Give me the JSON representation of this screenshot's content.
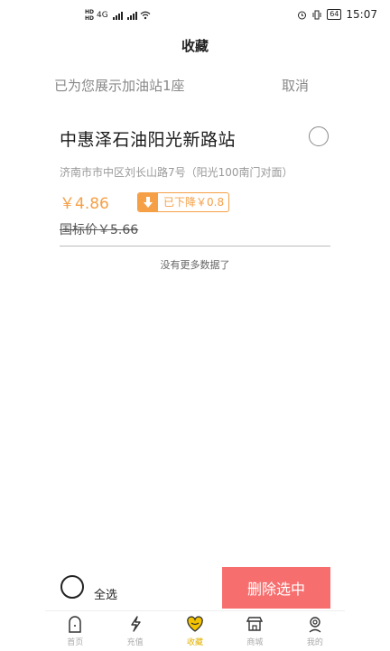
{
  "status_bar": {
    "time": "15:07",
    "battery": "64",
    "network": "4G"
  },
  "header": {
    "title": "收藏"
  },
  "info": {
    "text": "已为您展示加油站1座",
    "cancel_label": "取消"
  },
  "station": {
    "name": "中惠泽石油阳光新路站",
    "address": "济南市市中区刘长山路7号（阳光100南门对面）",
    "price": "￥4.86",
    "drop_text": "已下降￥0.8",
    "national_price": "国标价￥5.66"
  },
  "list": {
    "end_text": "没有更多数据了"
  },
  "footer": {
    "select_all_label": "全选",
    "delete_label": "删除选中"
  },
  "tabs": [
    {
      "label": "首页",
      "icon": "home-icon"
    },
    {
      "label": "充值",
      "icon": "lightning-icon"
    },
    {
      "label": "收藏",
      "icon": "heart-icon",
      "active": true
    },
    {
      "label": "商城",
      "icon": "shop-icon"
    },
    {
      "label": "我的",
      "icon": "profile-icon"
    }
  ],
  "colors": {
    "accent": "#f5a047",
    "delete": "#f76e6e",
    "active_tab": "#e2b200"
  }
}
